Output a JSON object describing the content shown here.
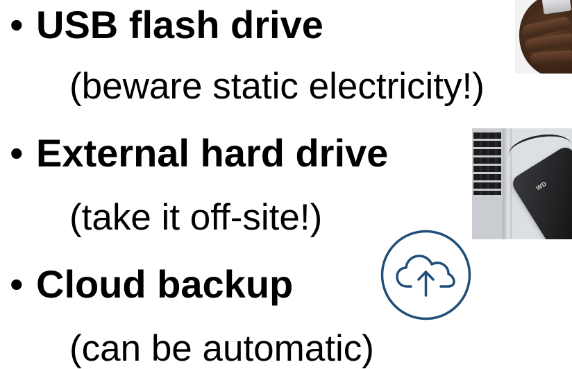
{
  "slide": {
    "bullet_char": "•",
    "items": [
      {
        "heading": "USB flash drive",
        "note": "(beware static electricity!)"
      },
      {
        "heading": "External hard drive",
        "note": "(take it off-site!)"
      },
      {
        "heading": "Cloud backup",
        "note": "(can be automatic)"
      }
    ]
  },
  "images": {
    "usb_photo": "hand holding usb flash drive",
    "hdd_photo": "laptop with external hard drive",
    "drive_brand": "WD",
    "cloud_icon": "cloud-upload-icon"
  },
  "colors": {
    "text": "#000000",
    "icon_stroke": "#1f4e79",
    "background": "#ffffff"
  }
}
